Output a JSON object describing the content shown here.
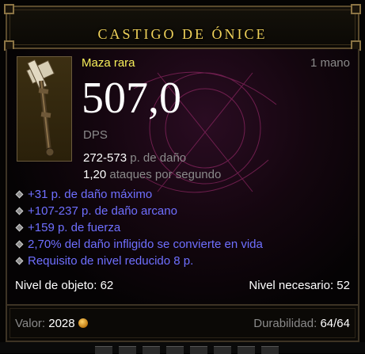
{
  "item": {
    "name": "CASTIGO DE ÓNICE",
    "type": "Maza rara",
    "hands": "1 mano",
    "dps_value": "507,0",
    "dps_label": "DPS",
    "damage": {
      "value": "272-573",
      "label": "p. de daño"
    },
    "speed": {
      "value": "1,20",
      "label": "ataques por segundo"
    },
    "affixes": [
      "+31 p. de daño máximo",
      "+107-237 p. de daño arcano",
      "+159 p. de fuerza",
      "2,70% del daño infligido se convierte en vida",
      "Requisito de nivel reducido 8 p."
    ],
    "item_level": "Nivel de objeto: 62",
    "required_level": "Nivel necesario: 52",
    "price": {
      "label": "Valor:",
      "value": "2028"
    },
    "durability": {
      "label": "Durabilidad:",
      "value": "64/64"
    }
  },
  "colors": {
    "title": "#f0d25a",
    "rare_type": "#f8f05a",
    "magic_affix": "#6f6fff",
    "label_gray": "#8a8a8a",
    "value_white": "#ffffff"
  },
  "icons": {
    "item": "mace-icon",
    "bullet": "diamond-bullet-icon",
    "gold": "gold-coin-icon"
  }
}
